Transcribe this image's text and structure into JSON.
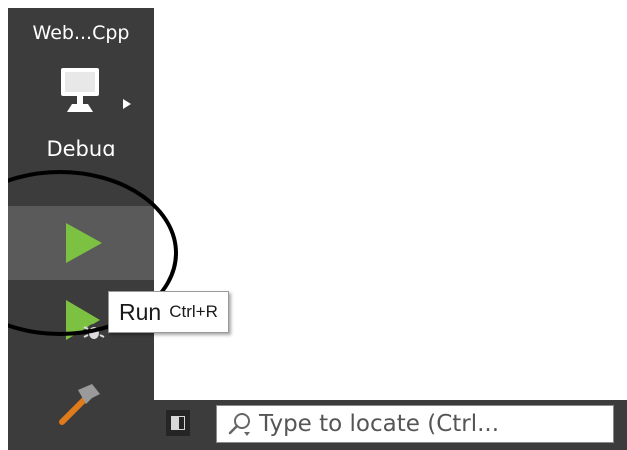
{
  "sidebar": {
    "project_name": "Web...Cpp",
    "build_config": "Debug",
    "kit_icon": "monitor-icon",
    "run_icon": "play-icon",
    "debug_icon": "debug-play-icon",
    "build_icon": "hammer-icon"
  },
  "tooltip": {
    "label": "Run",
    "shortcut": "Ctrl+R"
  },
  "statusbar": {
    "toggle_icon": "sidebar-toggle-icon",
    "locator_placeholder": "Type to locate (Ctrl..."
  },
  "colors": {
    "sidebar_bg": "#3c3c3c",
    "run_highlight": "#5a5a5a",
    "run_green": "#7dc142",
    "hammer_handle": "#e07b1c"
  }
}
